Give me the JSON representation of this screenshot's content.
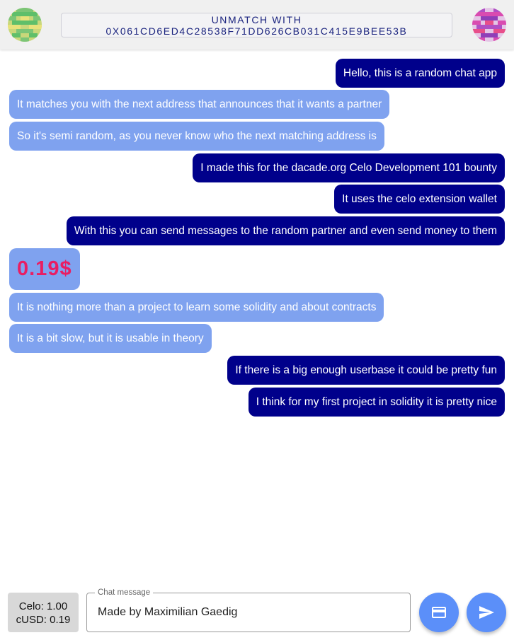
{
  "header": {
    "unmatch_label": "UNMATCH WITH 0X061CD6ED4C28538F71DD626CB031C415E9BEE53B",
    "left_avatar_icon": "identicon-green",
    "right_avatar_icon": "identicon-magenta"
  },
  "messages": [
    {
      "side": "out",
      "text": "Hello, this is a random chat app"
    },
    {
      "side": "in",
      "text": "It matches you with the next address that announces that it wants a partner"
    },
    {
      "side": "in",
      "text": "So it's semi random, as you never know who the next matching address is"
    },
    {
      "side": "out",
      "text": "I made this for the dacade.org Celo Development 101 bounty"
    },
    {
      "side": "out",
      "text": "It uses the celo extension wallet"
    },
    {
      "side": "out",
      "text": "With this you can send messages to the random partner and even send money to them"
    },
    {
      "side": "in",
      "type": "money",
      "text": "0.19$"
    },
    {
      "side": "in",
      "text": "It is nothing more than a project to learn some solidity and about contracts"
    },
    {
      "side": "in",
      "text": "It is a bit slow, but it is usable in theory"
    },
    {
      "side": "out",
      "text": "If there is a big enough userbase it could be pretty fun"
    },
    {
      "side": "out",
      "text": "I think for my first project in solidity it is pretty nice"
    }
  ],
  "footer": {
    "celo_balance": "Celo: 1.00",
    "cusd_balance": "cUSD: 0.19",
    "input_label": "Chat message",
    "input_value": "Made by Maximilian Gaedig",
    "pay_icon": "credit-card-icon",
    "send_icon": "send-icon"
  },
  "colors": {
    "outgoing_bubble": "#00008b",
    "incoming_bubble": "#7fa2ef",
    "money_text": "#e91e63",
    "fab": "#5b8ff9"
  }
}
